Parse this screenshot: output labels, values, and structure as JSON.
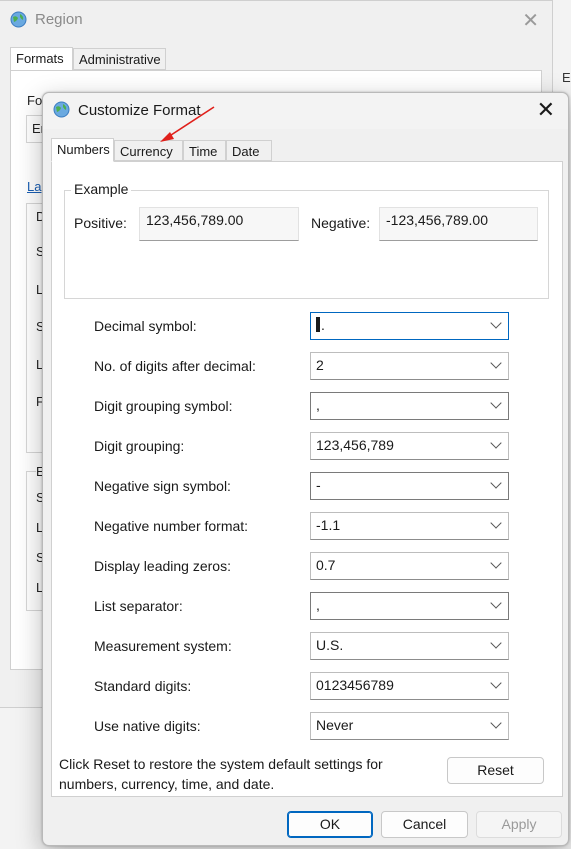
{
  "region_window": {
    "title": "Region",
    "tabs": [
      "Formats",
      "Administrative"
    ],
    "partial_labels": {
      "format": "Fo",
      "lang_dropdown": "En",
      "lang_link": "La",
      "g1": "D",
      "g2": "S",
      "g3": "L",
      "g4": "S",
      "g5": "L",
      "g6": "F",
      "g7": "E",
      "g8": "S",
      "g9": "L",
      "g10": "S",
      "g11": "L"
    },
    "right_edge": "E"
  },
  "dialog": {
    "title": "Customize Format",
    "tabs": [
      {
        "label": "Numbers",
        "active": true
      },
      {
        "label": "Currency",
        "active": false
      },
      {
        "label": "Time",
        "active": false
      },
      {
        "label": "Date",
        "active": false
      }
    ],
    "example": {
      "legend": "Example",
      "positive_label": "Positive:",
      "positive_value": "123,456,789.00",
      "negative_label": "Negative:",
      "negative_value": "-123,456,789.00"
    },
    "settings": [
      {
        "label": "Decimal symbol:",
        "value": "."
      },
      {
        "label": "No. of digits after decimal:",
        "value": "2"
      },
      {
        "label": "Digit grouping symbol:",
        "value": ","
      },
      {
        "label": "Digit grouping:",
        "value": "123,456,789"
      },
      {
        "label": "Negative sign symbol:",
        "value": "-"
      },
      {
        "label": "Negative number format:",
        "value": "-1.1"
      },
      {
        "label": "Display leading zeros:",
        "value": "0.7"
      },
      {
        "label": "List separator:",
        "value": ","
      },
      {
        "label": "Measurement system:",
        "value": "U.S."
      },
      {
        "label": "Standard digits:",
        "value": "0123456789"
      },
      {
        "label": "Use native digits:",
        "value": "Never"
      }
    ],
    "info_text": "Click Reset to restore the system default settings for numbers, currency, time, and date.",
    "buttons": {
      "reset": "Reset",
      "ok": "OK",
      "cancel": "Cancel",
      "apply": "Apply"
    },
    "close_glyph": "✕"
  },
  "colors": {
    "accent": "#0067c0",
    "annotation_arrow": "#e0201b",
    "link": "#1a5fb4"
  }
}
